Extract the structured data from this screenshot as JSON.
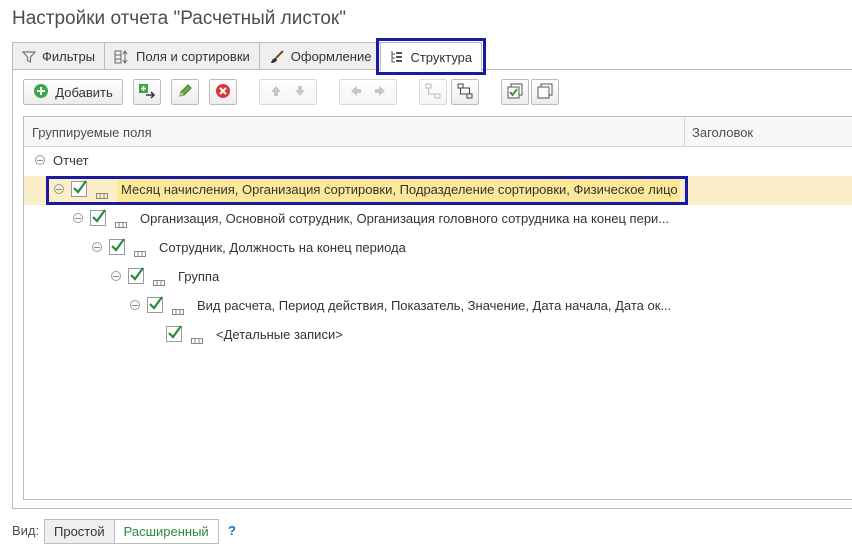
{
  "window": {
    "title": "Настройки отчета \"Расчетный листок\""
  },
  "tabs": [
    {
      "label": "Фильтры",
      "icon": "filter-icon"
    },
    {
      "label": "Поля и сортировки",
      "icon": "fields-sort-icon"
    },
    {
      "label": "Оформление",
      "icon": "brush-icon"
    },
    {
      "label": "Структура",
      "icon": "structure-icon",
      "active": true
    }
  ],
  "toolbar": {
    "add_label": "Добавить",
    "icons": [
      "add-icon",
      "new-group-icon",
      "edit-pencil-icon",
      "delete-icon",
      "move-up-icon",
      "move-down-icon",
      "move-left-icon",
      "move-right-icon",
      "group-icon",
      "ungroup-icon",
      "check-all-icon",
      "uncheck-all-icon"
    ]
  },
  "table": {
    "columns": [
      "Группируемые поля",
      "Заголовок"
    ],
    "rows": [
      {
        "text": "Отчет",
        "level": 0,
        "checkbox": false,
        "checked": false
      },
      {
        "text": "Месяц начисления, Организация сортировки, Подразделение сортировки, Физическое лицо",
        "level": 1,
        "checkbox": true,
        "checked": true,
        "selected": true
      },
      {
        "text": "Организация, Основной сотрудник, Организация головного сотрудника на конец пери...",
        "level": 2,
        "checkbox": true,
        "checked": true
      },
      {
        "text": "Сотрудник, Должность на конец периода",
        "level": 3,
        "checkbox": true,
        "checked": true
      },
      {
        "text": "Группа",
        "level": 4,
        "checkbox": true,
        "checked": true
      },
      {
        "text": "Вид расчета, Период действия, Показатель, Значение, Дата начала, Дата ок...",
        "level": 5,
        "checkbox": true,
        "checked": true
      },
      {
        "text": "<Детальные записи>",
        "level": 6,
        "checkbox": true,
        "checked": true,
        "leaf": true
      }
    ]
  },
  "footer": {
    "view_label": "Вид:",
    "mode_simple": "Простой",
    "mode_extended": "Расширенный",
    "help": "?"
  },
  "colors": {
    "highlight_border": "#1a1aa0",
    "selected_row": "#fbefc9",
    "accent_green": "#2a8a3a"
  }
}
